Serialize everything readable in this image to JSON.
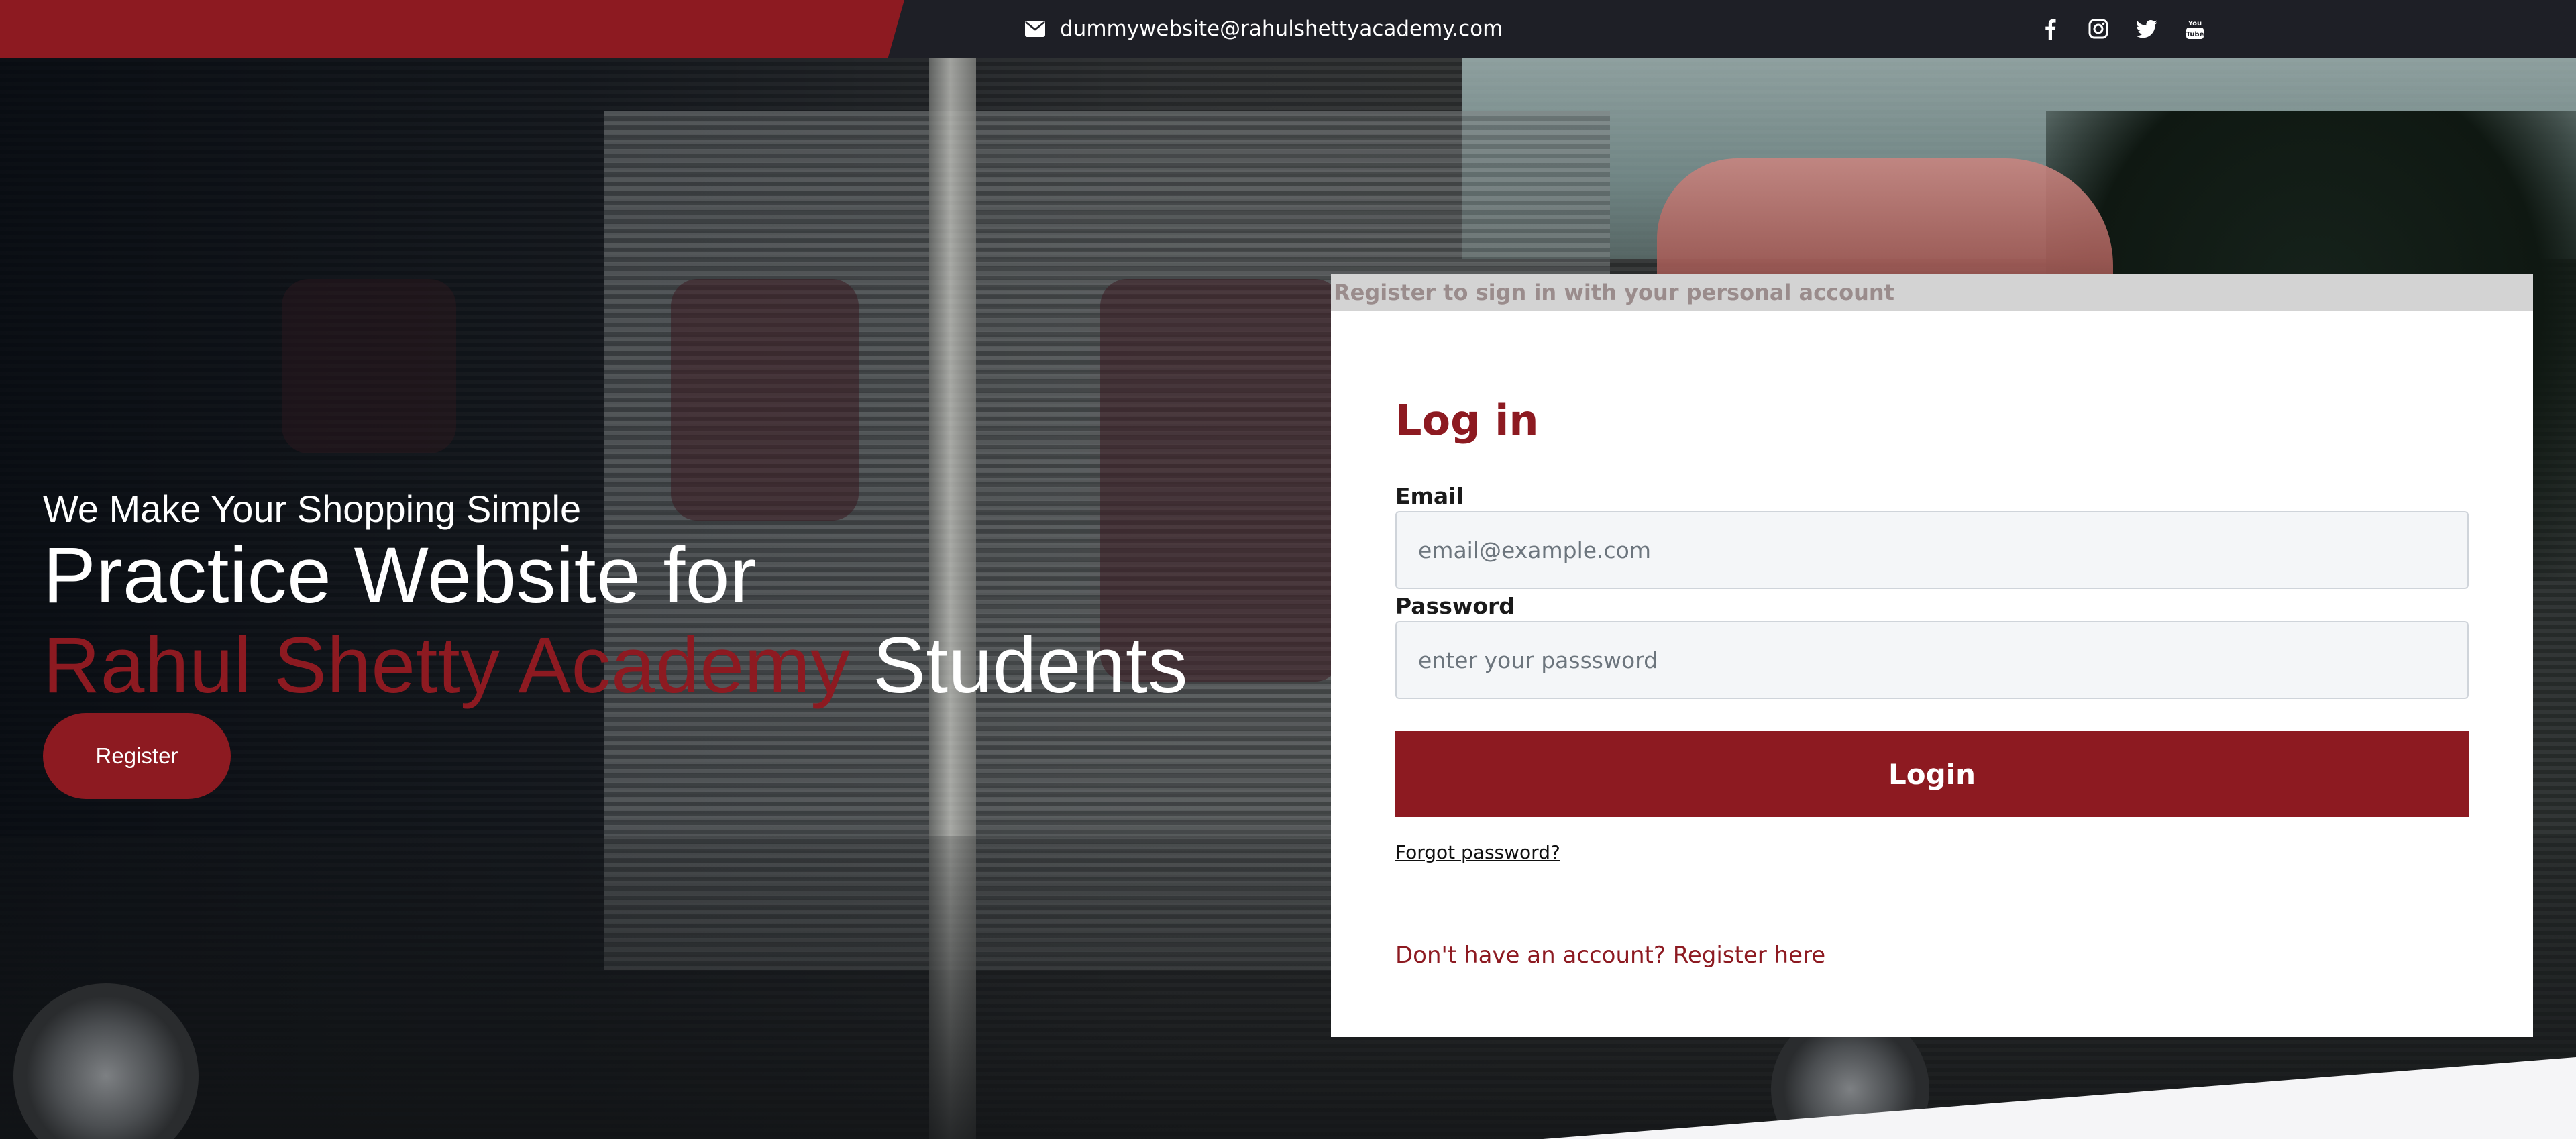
{
  "topbar": {
    "email": "dummywebsite@rahulshettyacademy.com",
    "email_icon": "envelope-icon",
    "social_icons": [
      "facebook-icon",
      "instagram-icon",
      "twitter-icon",
      "youtube-icon"
    ]
  },
  "hero": {
    "tagline": "We Make Your Shopping Simple",
    "headline_part1": "Practice Website for ",
    "headline_accent": "Rahul Shetty Academy",
    "headline_part2": " Students",
    "register_label": "Register"
  },
  "login": {
    "banner": "Register to sign in with your personal account",
    "title": "Log in",
    "email_label": "Email",
    "email_placeholder": "email@example.com",
    "email_value": "",
    "password_label": "Password",
    "password_placeholder": "enter your passsword",
    "password_value": "",
    "login_label": "Login",
    "forgot_label": "Forgot password?",
    "register_prompt": "Don't have an account? Register here"
  },
  "colors": {
    "brand": "#8d1a21",
    "topbar": "#1e1f26",
    "banner": "#d3d3d3"
  }
}
